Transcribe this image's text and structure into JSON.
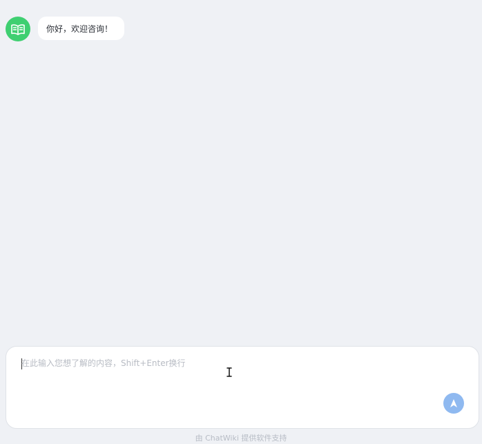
{
  "chat": {
    "messages": [
      {
        "sender": "assistant",
        "avatar_icon": "book-icon",
        "text": "你好，欢迎咨询！"
      }
    ]
  },
  "composer": {
    "value": "",
    "placeholder": "在此输入您想了解的内容，Shift+Enter换行",
    "send_icon": "send-icon"
  },
  "footer": {
    "text": "由 ChatWiki 提供软件支持"
  },
  "colors": {
    "background": "#eff1f5",
    "avatar": "#3fcf71",
    "send_button": "#8fb9f0",
    "bubble": "#ffffff"
  }
}
